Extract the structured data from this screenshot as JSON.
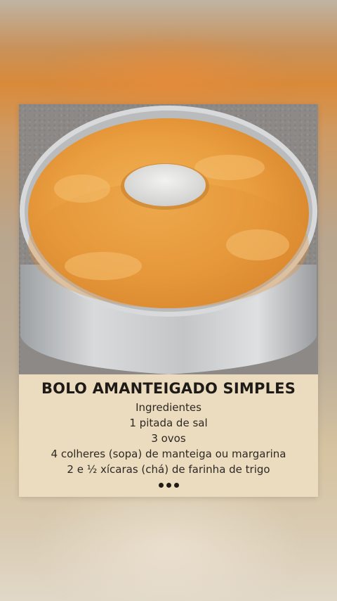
{
  "recipe": {
    "title": "BOLO AMANTEIGADO SIMPLES",
    "lines": [
      "Ingredientes",
      "1 pitada de sal",
      "3 ovos",
      "4 colheres (sopa) de manteiga ou margarina",
      "2 e ½ xícaras (chá) de farinha de trigo"
    ]
  },
  "photo": {
    "subject": "cake-in-tube-pan-image",
    "colors": {
      "cake": "#e89a3a",
      "pan": "#c4c6c8",
      "counter": "#8c8986"
    }
  },
  "more_icon": "ellipsis-icon"
}
